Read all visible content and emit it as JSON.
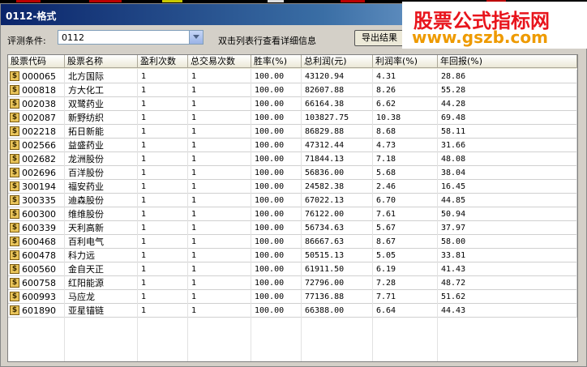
{
  "window": {
    "title": "0112-格式"
  },
  "toolbar": {
    "condition_label": "评测条件:",
    "condition_value": "0112",
    "hint": "双击列表行查看详细信息",
    "export_label": "导出结果"
  },
  "watermark": {
    "line1": "股票公式指标网",
    "line2": "www.gszb.com"
  },
  "colors": {
    "title_bar": "#0a246a",
    "watermark_red": "#e8141c",
    "watermark_orange": "#ee9a00"
  },
  "table": {
    "columns": [
      "股票代码",
      "股票名称",
      "盈利次数",
      "总交易次数",
      "胜率(%)",
      "总利润(元)",
      "利润率(%)",
      "年回报(%)"
    ],
    "rows": [
      [
        "000065",
        "北方国际",
        "1",
        "1",
        "100.00",
        "43120.94",
        "4.31",
        "28.86"
      ],
      [
        "000818",
        "方大化工",
        "1",
        "1",
        "100.00",
        "82607.88",
        "8.26",
        "55.28"
      ],
      [
        "002038",
        "双鹭药业",
        "1",
        "1",
        "100.00",
        "66164.38",
        "6.62",
        "44.28"
      ],
      [
        "002087",
        "新野纺织",
        "1",
        "1",
        "100.00",
        "103827.75",
        "10.38",
        "69.48"
      ],
      [
        "002218",
        "拓日新能",
        "1",
        "1",
        "100.00",
        "86829.88",
        "8.68",
        "58.11"
      ],
      [
        "002566",
        "益盛药业",
        "1",
        "1",
        "100.00",
        "47312.44",
        "4.73",
        "31.66"
      ],
      [
        "002682",
        "龙洲股份",
        "1",
        "1",
        "100.00",
        "71844.13",
        "7.18",
        "48.08"
      ],
      [
        "002696",
        "百洋股份",
        "1",
        "1",
        "100.00",
        "56836.00",
        "5.68",
        "38.04"
      ],
      [
        "300194",
        "福安药业",
        "1",
        "1",
        "100.00",
        "24582.38",
        "2.46",
        "16.45"
      ],
      [
        "300335",
        "迪森股份",
        "1",
        "1",
        "100.00",
        "67022.13",
        "6.70",
        "44.85"
      ],
      [
        "600300",
        "维维股份",
        "1",
        "1",
        "100.00",
        "76122.00",
        "7.61",
        "50.94"
      ],
      [
        "600339",
        "天利高新",
        "1",
        "1",
        "100.00",
        "56734.63",
        "5.67",
        "37.97"
      ],
      [
        "600468",
        "百利电气",
        "1",
        "1",
        "100.00",
        "86667.63",
        "8.67",
        "58.00"
      ],
      [
        "600478",
        "科力远",
        "1",
        "1",
        "100.00",
        "50515.13",
        "5.05",
        "33.81"
      ],
      [
        "600560",
        "金自天正",
        "1",
        "1",
        "100.00",
        "61911.50",
        "6.19",
        "41.43"
      ],
      [
        "600758",
        "红阳能源",
        "1",
        "1",
        "100.00",
        "72796.00",
        "7.28",
        "48.72"
      ],
      [
        "600993",
        "马应龙",
        "1",
        "1",
        "100.00",
        "77136.88",
        "7.71",
        "51.62"
      ],
      [
        "601890",
        "亚星锚链",
        "1",
        "1",
        "100.00",
        "66388.00",
        "6.64",
        "44.43"
      ]
    ]
  }
}
